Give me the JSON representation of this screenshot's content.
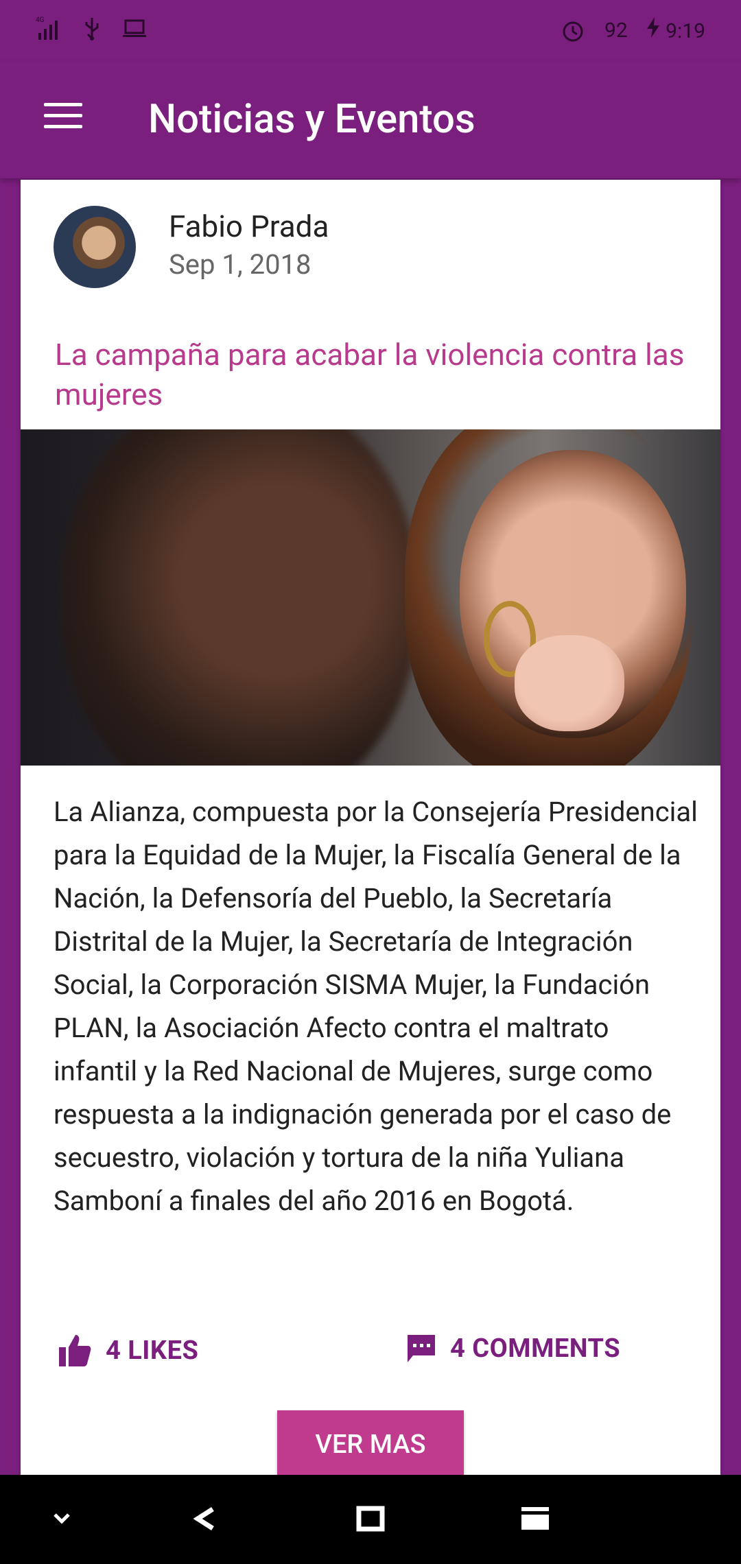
{
  "status_bar": {
    "network": "4G",
    "battery": "92",
    "time": "9:19",
    "icons": [
      "signal-icon",
      "usb-icon",
      "laptop-icon",
      "alarm-icon",
      "charging-icon"
    ]
  },
  "app_bar": {
    "title": "Noticias y Eventos",
    "menu_icon": "hamburger-menu-icon"
  },
  "post": {
    "author": "Fabio Prada",
    "date": "Sep 1, 2018",
    "title": "La campaña para acabar la violencia contra las mujeres",
    "body": "La Alianza, compuesta por la Consejería Presidencial para la Equidad de la Mujer, la Fiscalía General de la Nación, la Defensoría del Pueblo, la Secretaría Distrital de la Mujer, la Secretaría de Integración Social, la Corporación SISMA Mujer, la Fundación PLAN, la Asociación Afecto contra el maltrato infantil y la Red Nacional de Mujeres, surge como respuesta a la indignación generada por el caso de secuestro, violación y tortura de la niña Yuliana Samboní a finales del año 2016 en Bogotá.",
    "likes_label": "4 LIKES",
    "comments_label": "4 COMMENTS",
    "more_label": "VER MAS"
  },
  "nav_bar": {
    "icons": [
      "chevron-down-icon",
      "back-icon",
      "home-icon",
      "recents-icon"
    ]
  },
  "colors": {
    "primary": "#7b1f7f",
    "accent": "#c03a8e",
    "headline": "#b83a8c"
  }
}
